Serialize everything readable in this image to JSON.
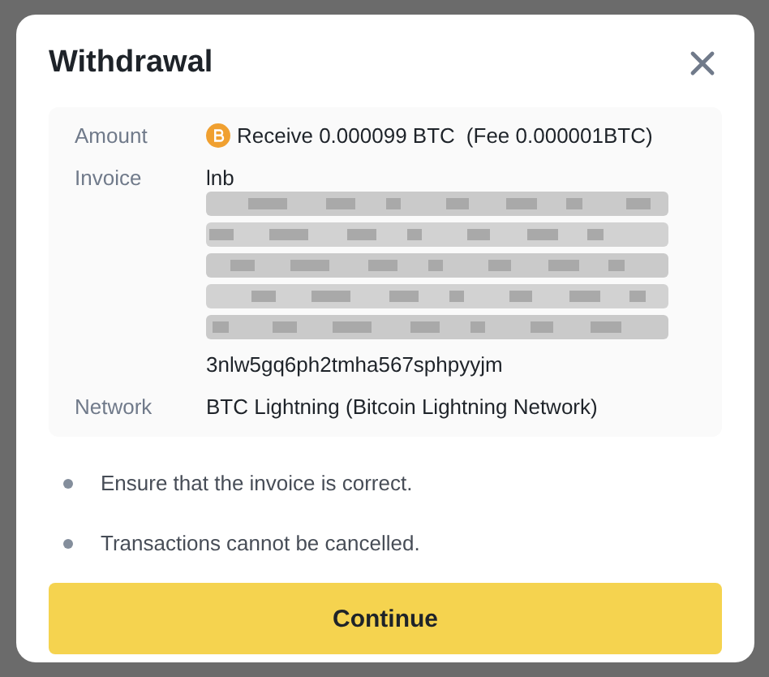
{
  "dialog": {
    "title": "Withdrawal"
  },
  "details": [
    {
      "kind": "amount",
      "label": "Amount",
      "value": "Receive 0.000099 BTC",
      "fee": "(Fee 0.000001BTC)"
    },
    {
      "kind": "invoice",
      "label": "Invoice",
      "start": "lnb",
      "end": "3nlw5gq6ph2tmha567sphpyyjm"
    },
    {
      "kind": "text",
      "label": "Network",
      "value": "BTC Lightning (Bitcoin Lightning Network)"
    }
  ],
  "notes": [
    "Ensure that the invoice is correct.",
    "Transactions cannot be cancelled."
  ],
  "button": "Continue"
}
